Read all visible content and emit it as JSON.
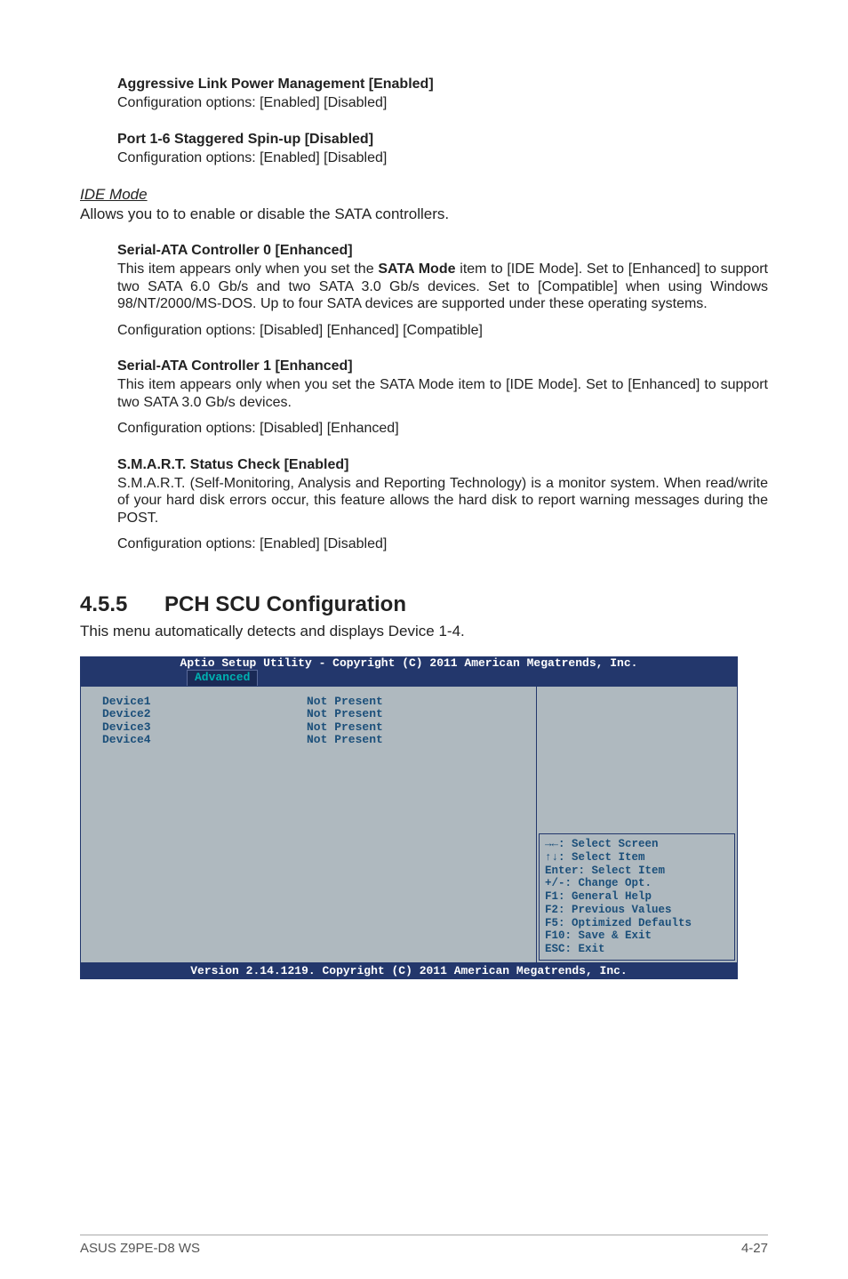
{
  "top": {
    "agg_title": "Aggressive Link Power Management [Enabled]",
    "agg_body": "Configuration options: [Enabled] [Disabled]",
    "port_title": "Port 1-6 Staggered Spin-up [Disabled]",
    "port_body": "Configuration options: [Enabled] [Disabled]"
  },
  "ide": {
    "title": "IDE Mode",
    "body": "Allows you to to enable or disable the SATA controllers.",
    "s0_title": "Serial-ATA Controller 0 [Enhanced]",
    "s0_p1a": "This item appears only when you set the ",
    "s0_p1b": "SATA Mode",
    "s0_p1c": " item to [IDE Mode]. Set to [Enhanced] to support two SATA 6.0 Gb/s and two SATA 3.0 Gb/s devices. Set to [Compatible] when using Windows 98/NT/2000/MS-DOS. Up to four SATA devices are supported under these operating systems.",
    "s0_p2": "Configuration options: [Disabled] [Enhanced] [Compatible]",
    "s1_title": "Serial-ATA Controller 1 [Enhanced]",
    "s1_p1": "This item appears only when you set the SATA Mode item to [IDE Mode]. Set to [Enhanced] to support two SATA 3.0 Gb/s devices.",
    "s1_p2": "Configuration options: [Disabled] [Enhanced]",
    "sm_title": "S.M.A.R.T. Status Check [Enabled]",
    "sm_p1": "S.M.A.R.T. (Self-Monitoring, Analysis and Reporting Technology) is a monitor system. When read/write of your hard disk errors occur, this feature allows the hard disk to report warning messages during the POST.",
    "sm_p2": "Configuration options: [Enabled] [Disabled]"
  },
  "section": {
    "num": "4.5.5",
    "title": "PCH SCU Configuration",
    "desc": "This menu automatically detects and displays Device 1-4."
  },
  "bios": {
    "title": "Aptio Setup Utility - Copyright (C) 2011 American Megatrends, Inc.",
    "tab": "Advanced",
    "devices": [
      {
        "name": "Device1",
        "state": "Not Present"
      },
      {
        "name": "Device2",
        "state": "Not Present"
      },
      {
        "name": "Device3",
        "state": "Not Present"
      },
      {
        "name": "Device4",
        "state": "Not Present"
      }
    ],
    "help": {
      "l1": "→←: Select Screen",
      "l2": "↑↓:  Select Item",
      "l3": "Enter: Select Item",
      "l4": "+/-: Change Opt.",
      "l5": "F1: General Help",
      "l6": "F2: Previous Values",
      "l7": "F5: Optimized Defaults",
      "l8": "F10: Save & Exit",
      "l9": "ESC: Exit"
    },
    "footer": "Version 2.14.1219. Copyright (C) 2011 American Megatrends, Inc."
  },
  "footer": {
    "left": "ASUS Z9PE-D8 WS",
    "right": "4-27"
  }
}
